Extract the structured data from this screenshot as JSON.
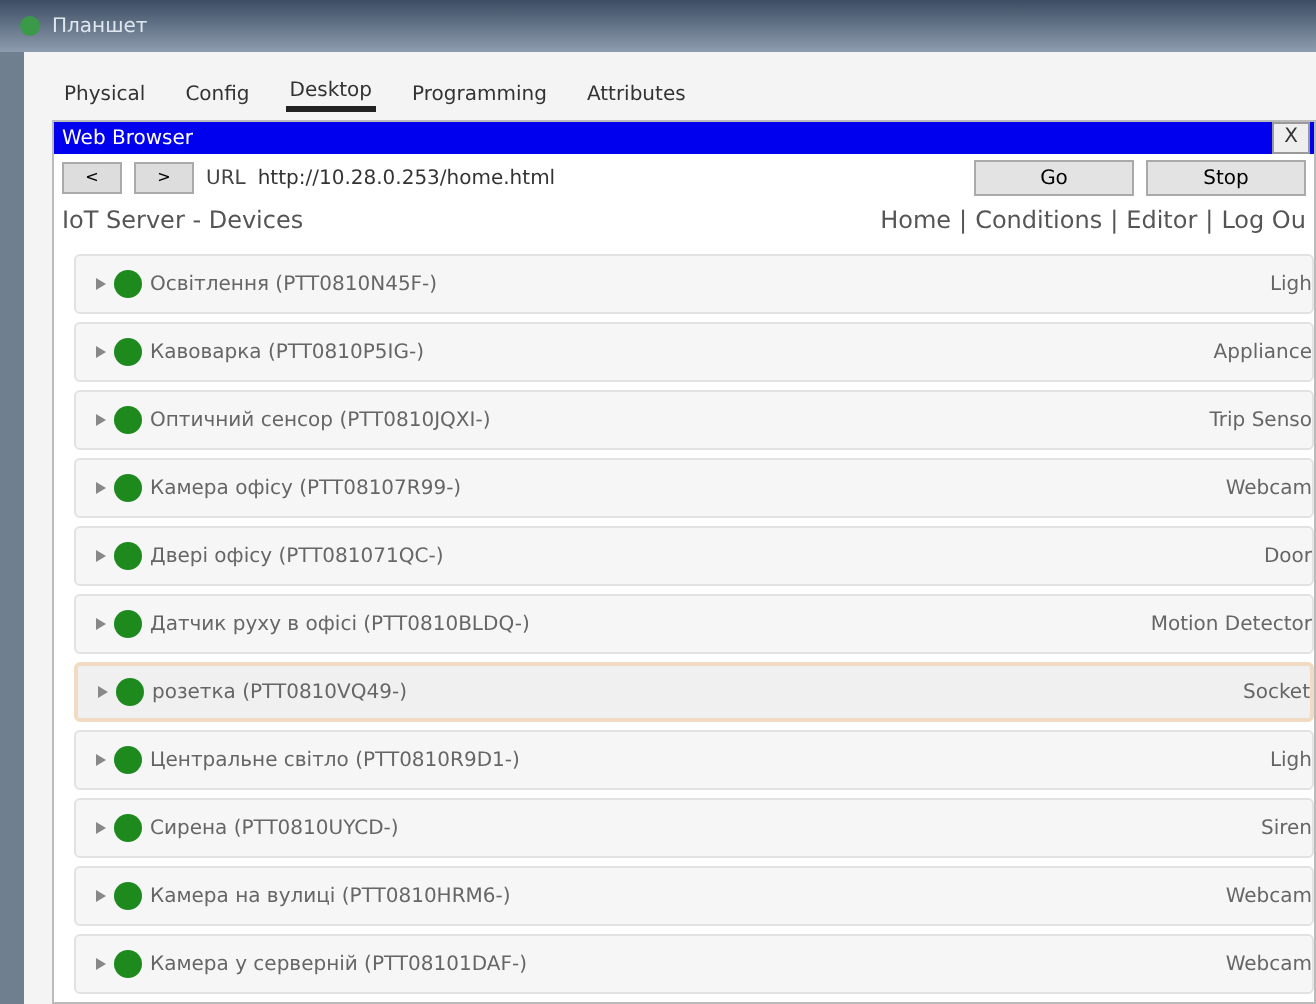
{
  "window": {
    "title": "Планшет"
  },
  "tabs": [
    {
      "label": "Physical",
      "selected": false
    },
    {
      "label": "Config",
      "selected": false
    },
    {
      "label": "Desktop",
      "selected": true
    },
    {
      "label": "Programming",
      "selected": false
    },
    {
      "label": "Attributes",
      "selected": false
    }
  ],
  "browser": {
    "title": "Web Browser",
    "close": "X",
    "back": "<",
    "forward": ">",
    "url_label": "URL",
    "url": "http://10.28.0.253/home.html",
    "go": "Go",
    "stop": "Stop"
  },
  "page": {
    "heading": "IoT Server - Devices",
    "nav": [
      "Home",
      "|",
      "Conditions",
      "|",
      "Editor",
      "|",
      "Log Ou"
    ]
  },
  "devices": [
    {
      "name": "Освітлення (PTT0810N45F-)",
      "type": "Ligh",
      "online": true,
      "selected": false
    },
    {
      "name": "Кавоварка (PTT0810P5IG-)",
      "type": "Appliance",
      "online": true,
      "selected": false
    },
    {
      "name": "Оптичний сенсор (PTT0810JQXI-)",
      "type": "Trip Senso",
      "online": true,
      "selected": false
    },
    {
      "name": "Камера офісу (PTT08107R99-)",
      "type": "Webcam",
      "online": true,
      "selected": false
    },
    {
      "name": "Двері офісу (PTT081071QC-)",
      "type": "Door",
      "online": true,
      "selected": false
    },
    {
      "name": "Датчик руху в офісі (PTT0810BLDQ-)",
      "type": "Motion Detector",
      "online": true,
      "selected": false
    },
    {
      "name": "розетка (PTT0810VQ49-)",
      "type": "Socket",
      "online": true,
      "selected": true
    },
    {
      "name": "Центральне світло (PTT0810R9D1-)",
      "type": "Ligh",
      "online": true,
      "selected": false
    },
    {
      "name": "Сирена (PTT0810UYCD-)",
      "type": "Siren",
      "online": true,
      "selected": false
    },
    {
      "name": "Камера на вулиці (PTT0810HRM6-)",
      "type": "Webcam",
      "online": true,
      "selected": false
    },
    {
      "name": "Камера у серверній (PTT08101DAF-)",
      "type": "Webcam",
      "online": true,
      "selected": false
    }
  ]
}
